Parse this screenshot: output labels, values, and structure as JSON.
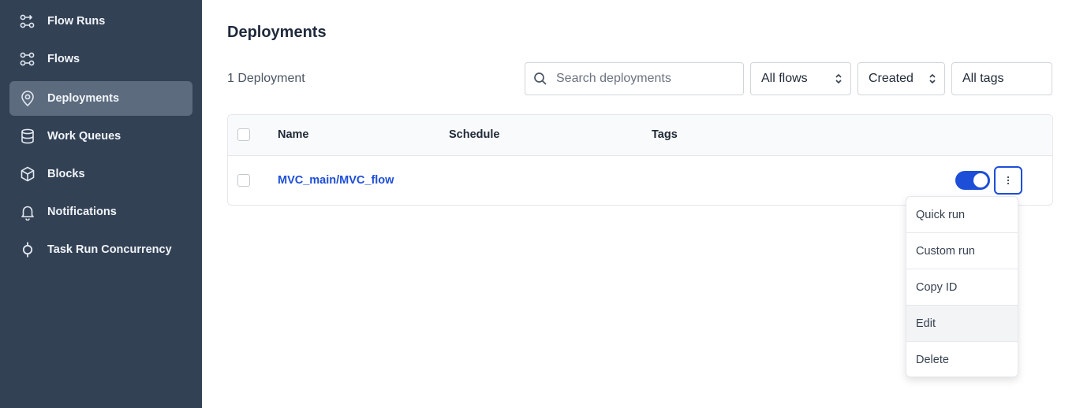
{
  "sidebar": {
    "items": [
      {
        "label": "Flow Runs",
        "icon": "flow-runs-icon"
      },
      {
        "label": "Flows",
        "icon": "flows-icon"
      },
      {
        "label": "Deployments",
        "icon": "map-pin-icon",
        "active": true
      },
      {
        "label": "Work Queues",
        "icon": "database-icon"
      },
      {
        "label": "Blocks",
        "icon": "cube-icon"
      },
      {
        "label": "Notifications",
        "icon": "bell-icon"
      },
      {
        "label": "Task Run Concurrency",
        "icon": "concurrency-icon"
      }
    ]
  },
  "main": {
    "title": "Deployments",
    "count": "1 Deployment",
    "search": {
      "placeholder": "Search deployments"
    },
    "filters": {
      "flows": "All flows",
      "sort": "Created",
      "tags": "All tags"
    },
    "table": {
      "headers": {
        "name": "Name",
        "schedule": "Schedule",
        "tags": "Tags"
      },
      "rows": [
        {
          "name": "MVC_main/MVC_flow",
          "schedule": "",
          "tags": "",
          "active": true
        }
      ]
    },
    "menu": {
      "items": [
        "Quick run",
        "Custom run",
        "Copy ID",
        "Edit",
        "Delete"
      ],
      "hovered": "Edit"
    }
  },
  "colors": {
    "sidebar_bg": "#334155",
    "sidebar_active": "#5c6b7e",
    "accent": "#1d4ed8"
  }
}
